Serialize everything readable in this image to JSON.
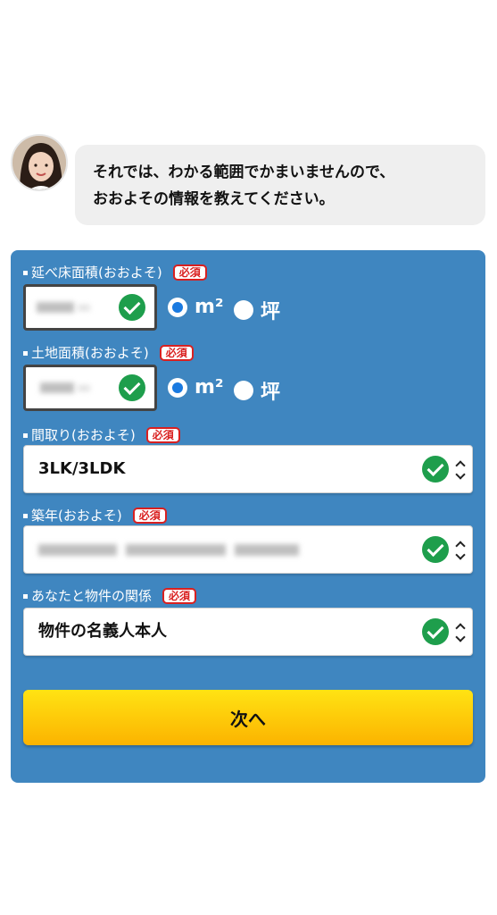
{
  "chat": {
    "line1": "それでは、わかる範囲でかまいませんので、",
    "line2": "おおよその情報を教えてください。"
  },
  "form": {
    "floor_area": {
      "label": "延べ床面積(おおよそ)",
      "required_badge": "必須",
      "unit_options": [
        "m²",
        "坪"
      ],
      "selected_unit": "m²"
    },
    "land_area": {
      "label": "土地面積(おおよそ)",
      "required_badge": "必須",
      "unit_options": [
        "m²",
        "坪"
      ],
      "selected_unit": "m²"
    },
    "layout": {
      "label": "間取り(おおよそ)",
      "required_badge": "必須",
      "value": "3LK/3LDK"
    },
    "building_age": {
      "label": "築年(おおよそ)",
      "required_badge": "必須"
    },
    "relation": {
      "label": "あなたと物件の関係",
      "required_badge": "必須",
      "value": "物件の名義人本人"
    },
    "next_button": "次へ"
  },
  "colors": {
    "panel": "#3f86c0",
    "check": "#1e9e4c",
    "badge": "#d92020",
    "radio_selected": "#1a7ae0",
    "button_top": "#ffe313",
    "button_bottom": "#fcb300"
  }
}
